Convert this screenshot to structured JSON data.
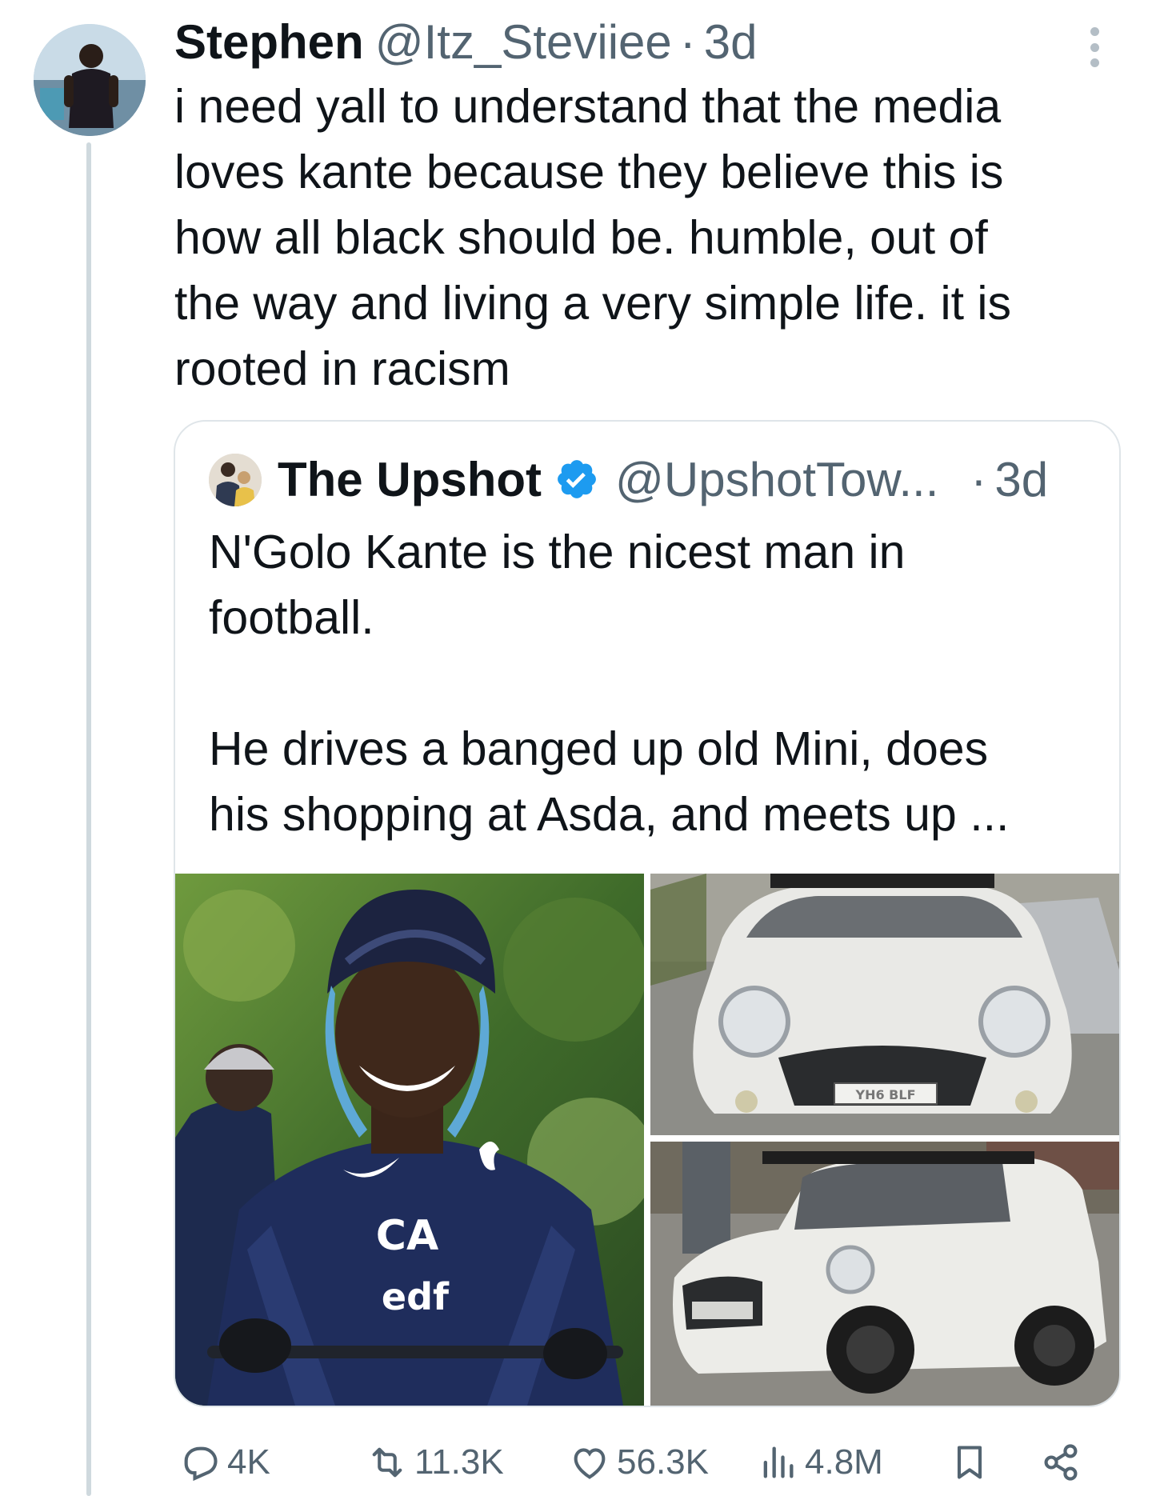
{
  "post": {
    "display_name": "Stephen",
    "handle": "@Itz_Steviiee",
    "separator": "·",
    "age": "3d",
    "text": "i need yall to understand that the media\nloves kante because they believe this is\nhow all black should be. humble, out of\nthe way and living a very simple life. it is\nrooted in racism"
  },
  "quote": {
    "display_name": "The Upshot",
    "handle": "@UpshotTow...",
    "separator": "·",
    "age": "3d",
    "verified": true,
    "text": "N'Golo Kante is the nicest man in\nfootball.\n\nHe drives a banged up old Mini, does\nhis shopping at Asda, and meets up ...",
    "media": {
      "photo_main": {
        "shirt_logo_top": "CA",
        "shirt_logo_bottom": "edf"
      },
      "photo_top": {
        "plate": "YH6 BLF"
      },
      "photo_bottom": {}
    }
  },
  "actions": {
    "replies": "4K",
    "reposts": "11.3K",
    "likes": "56.3K",
    "views": "4.8M"
  },
  "colors": {
    "text": "#0f1419",
    "secondary": "#536471",
    "verified": "#1d9bf0",
    "border": "#dfe5e9"
  },
  "icons": [
    "more-icon",
    "verified-icon",
    "reply-icon",
    "repost-icon",
    "like-icon",
    "views-icon",
    "bookmark-icon",
    "share-icon"
  ]
}
